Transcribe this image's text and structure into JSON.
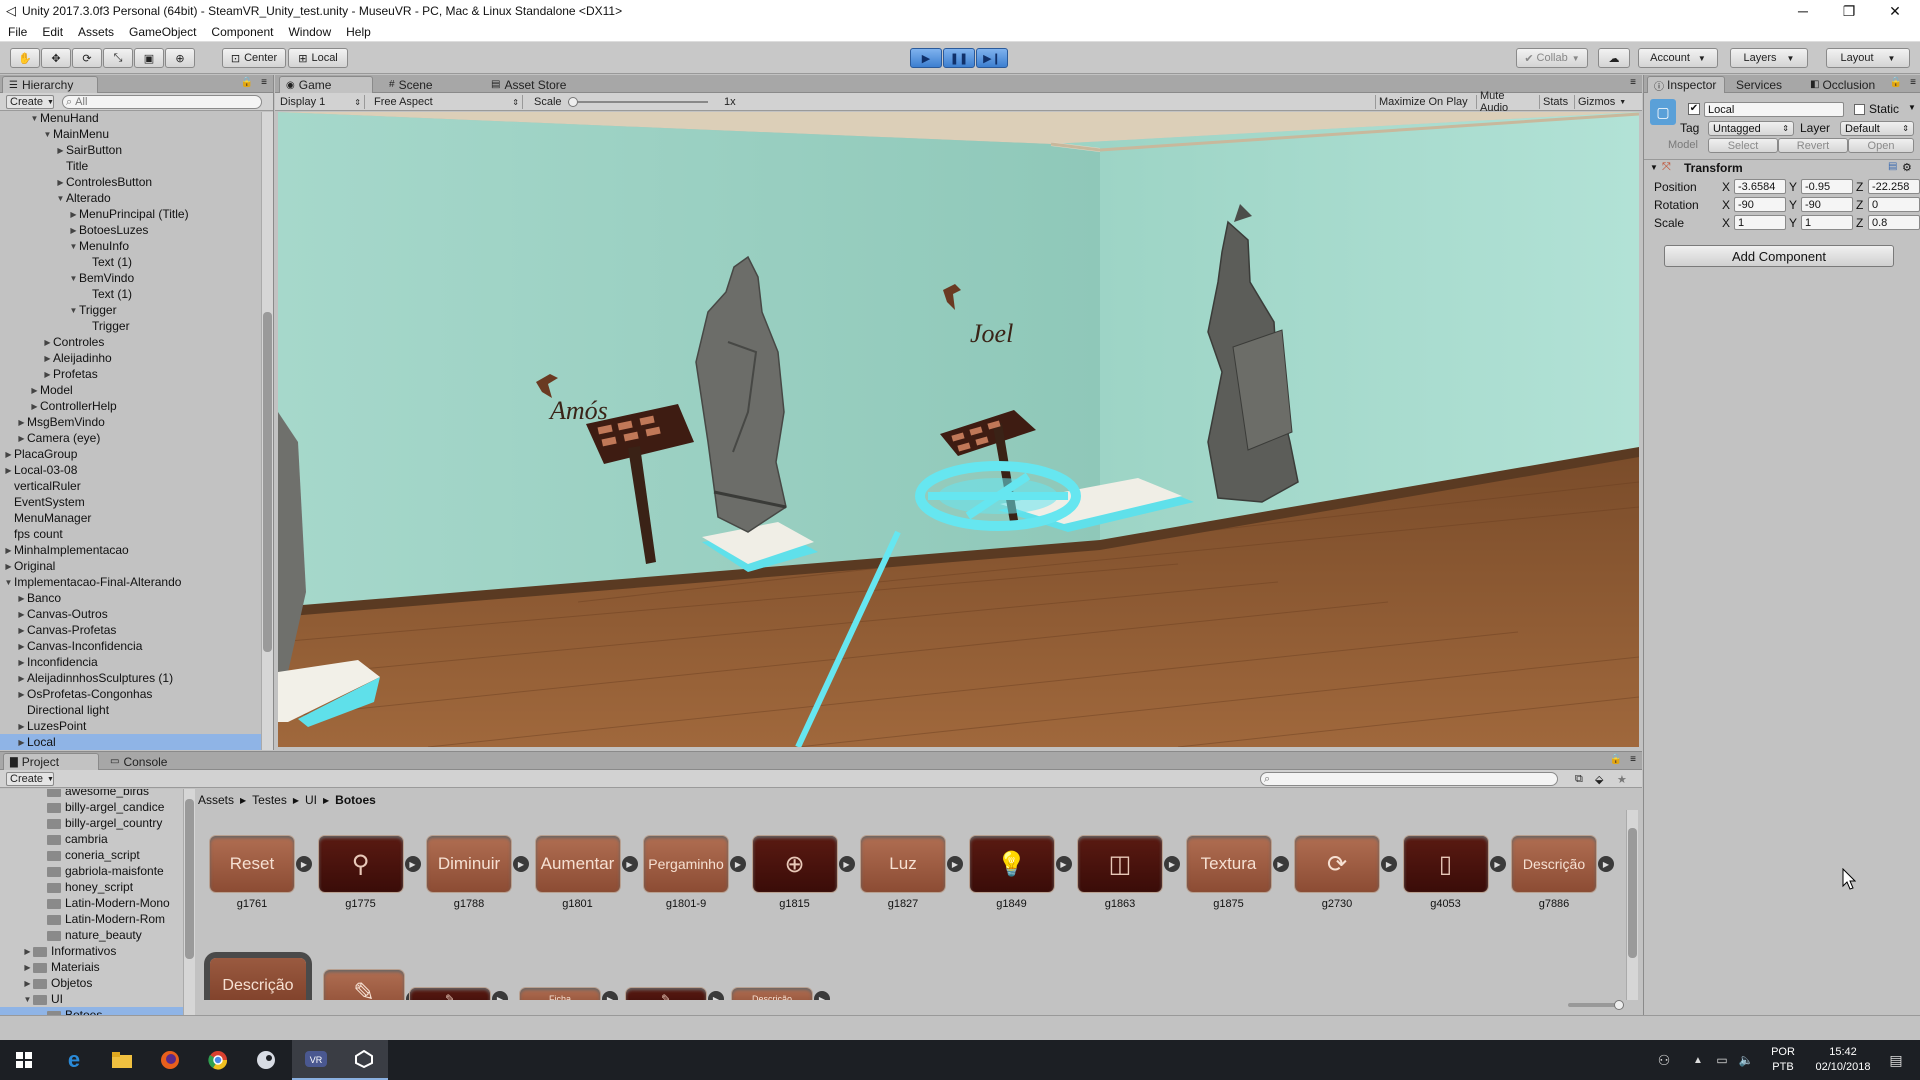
{
  "window": {
    "title": "Unity 2017.3.0f3 Personal (64bit) - SteamVR_Unity_test.unity - MuseuVR - PC, Mac & Linux Standalone <DX11>",
    "controls": [
      "─",
      "❐",
      "✕"
    ]
  },
  "menu": [
    "File",
    "Edit",
    "Assets",
    "GameObject",
    "Component",
    "Window",
    "Help"
  ],
  "toolbar": {
    "pivot": "Center",
    "space": "Local",
    "collab": "Collab",
    "account": "Account",
    "layers": "Layers",
    "layout": "Layout"
  },
  "hierarchy": {
    "tab": "Hierarchy",
    "create": "Create",
    "search_placeholder": "All",
    "rows": [
      {
        "label": "MenuHand",
        "indent": 3,
        "arrow": "down"
      },
      {
        "label": "MainMenu",
        "indent": 4,
        "arrow": "down"
      },
      {
        "label": "SairButton",
        "indent": 5,
        "arrow": "right"
      },
      {
        "label": "Title",
        "indent": 5,
        "arrow": ""
      },
      {
        "label": "ControlesButton",
        "indent": 5,
        "arrow": "right"
      },
      {
        "label": "Alterado",
        "indent": 5,
        "arrow": "down"
      },
      {
        "label": "MenuPrincipal (Title)",
        "indent": 6,
        "arrow": "right"
      },
      {
        "label": "BotoesLuzes",
        "indent": 6,
        "arrow": "right"
      },
      {
        "label": "MenuInfo",
        "indent": 6,
        "arrow": "down"
      },
      {
        "label": "Text (1)",
        "indent": 7,
        "arrow": ""
      },
      {
        "label": "BemVindo",
        "indent": 6,
        "arrow": "down"
      },
      {
        "label": "Text (1)",
        "indent": 7,
        "arrow": ""
      },
      {
        "label": "Trigger",
        "indent": 6,
        "arrow": "down"
      },
      {
        "label": "Trigger",
        "indent": 7,
        "arrow": ""
      },
      {
        "label": "Controles",
        "indent": 4,
        "arrow": "right"
      },
      {
        "label": "Aleijadinho",
        "indent": 4,
        "arrow": "right"
      },
      {
        "label": "Profetas",
        "indent": 4,
        "arrow": "right"
      },
      {
        "label": "Model",
        "indent": 3,
        "arrow": "right"
      },
      {
        "label": "ControllerHelp",
        "indent": 3,
        "arrow": "right"
      },
      {
        "label": "MsgBemVindo",
        "indent": 2,
        "arrow": "right"
      },
      {
        "label": "Camera (eye)",
        "indent": 2,
        "arrow": "right"
      },
      {
        "label": "PlacaGroup",
        "indent": 1,
        "arrow": "right"
      },
      {
        "label": "Local-03-08",
        "indent": 1,
        "arrow": "right"
      },
      {
        "label": "verticalRuler",
        "indent": 1,
        "arrow": ""
      },
      {
        "label": "EventSystem",
        "indent": 1,
        "arrow": ""
      },
      {
        "label": "MenuManager",
        "indent": 1,
        "arrow": ""
      },
      {
        "label": "fps count",
        "indent": 1,
        "arrow": ""
      },
      {
        "label": "MinhaImplementacao",
        "indent": 1,
        "arrow": "right"
      },
      {
        "label": "Original",
        "indent": 1,
        "arrow": "right"
      },
      {
        "label": "Implementacao-Final-Alterando",
        "indent": 1,
        "arrow": "down"
      },
      {
        "label": "Banco",
        "indent": 2,
        "arrow": "right"
      },
      {
        "label": "Canvas-Outros",
        "indent": 2,
        "arrow": "right"
      },
      {
        "label": "Canvas-Profetas",
        "indent": 2,
        "arrow": "right"
      },
      {
        "label": "Canvas-Inconfidencia",
        "indent": 2,
        "arrow": "right"
      },
      {
        "label": "Inconfidencia",
        "indent": 2,
        "arrow": "right"
      },
      {
        "label": "AleijadinnhosSculptures (1)",
        "indent": 2,
        "arrow": "right"
      },
      {
        "label": "OsProfetas-Congonhas",
        "indent": 2,
        "arrow": "right"
      },
      {
        "label": "Directional light",
        "indent": 2,
        "arrow": ""
      },
      {
        "label": "LuzesPoint",
        "indent": 2,
        "arrow": "right"
      },
      {
        "label": "Local",
        "indent": 2,
        "arrow": "right",
        "selected": true
      }
    ]
  },
  "game": {
    "tabs": [
      "Game",
      "Scene",
      "Asset Store"
    ],
    "display": "Display 1",
    "aspect": "Free Aspect",
    "scale_label": "Scale",
    "scale_value": "1x",
    "options": [
      "Maximize On Play",
      "Mute Audio",
      "Stats",
      "Gizmos"
    ],
    "scene_labels": [
      "Amós",
      "Joel"
    ]
  },
  "inspector": {
    "tabs": [
      "Inspector",
      "Services",
      "Occlusion"
    ],
    "name": "Local",
    "static": "Static",
    "tag_label": "Tag",
    "tag": "Untagged",
    "layer_label": "Layer",
    "layer": "Default",
    "model_label": "Model",
    "model_buttons": [
      "Select",
      "Revert",
      "Open"
    ],
    "component": "Transform",
    "transform": [
      {
        "label": "Position",
        "x": "-3.6584",
        "y": "-0.95",
        "z": "-22.258"
      },
      {
        "label": "Rotation",
        "x": "-90",
        "y": "-90",
        "z": "0"
      },
      {
        "label": "Scale",
        "x": "1",
        "y": "1",
        "z": "0.8"
      }
    ],
    "axis": [
      "X",
      "Y",
      "Z"
    ],
    "add_component": "Add Component"
  },
  "project": {
    "tabs": [
      "Project",
      "Console"
    ],
    "create": "Create",
    "folders": [
      {
        "label": "awesome_birds",
        "indent": 3
      },
      {
        "label": "billy-argel_candice",
        "indent": 3
      },
      {
        "label": "billy-argel_country",
        "indent": 3
      },
      {
        "label": "cambria",
        "indent": 3
      },
      {
        "label": "coneria_script",
        "indent": 3
      },
      {
        "label": "gabriola-maisfonte",
        "indent": 3
      },
      {
        "label": "honey_script",
        "indent": 3
      },
      {
        "label": "Latin-Modern-Mono",
        "indent": 3
      },
      {
        "label": "Latin-Modern-Rom",
        "indent": 3
      },
      {
        "label": "nature_beauty",
        "indent": 3
      },
      {
        "label": "Informativos",
        "indent": 2,
        "arrow": "right"
      },
      {
        "label": "Materiais",
        "indent": 2,
        "arrow": "right"
      },
      {
        "label": "Objetos",
        "indent": 2,
        "arrow": "right"
      },
      {
        "label": "UI",
        "indent": 2,
        "arrow": "down"
      },
      {
        "label": "Botoes",
        "indent": 3,
        "selected": true
      }
    ],
    "breadcrumb": [
      "Assets",
      "Testes",
      "UI",
      "Botoes"
    ],
    "assets_row1": [
      {
        "label": "Reset",
        "name": "g1761",
        "style": "light",
        "kind": "text"
      },
      {
        "label": "",
        "name": "g1775",
        "style": "dark",
        "kind": "search-icon"
      },
      {
        "label": "Diminuir",
        "name": "g1788",
        "style": "light",
        "kind": "text"
      },
      {
        "label": "Aumentar",
        "name": "g1801",
        "style": "light",
        "kind": "text"
      },
      {
        "label": "Pergaminho",
        "name": "g1801-9",
        "style": "light",
        "kind": "text"
      },
      {
        "label": "",
        "name": "g1815",
        "style": "dark",
        "kind": "zoom-icon"
      },
      {
        "label": "Luz",
        "name": "g1827",
        "style": "light",
        "kind": "text"
      },
      {
        "label": "",
        "name": "g1849",
        "style": "dark",
        "kind": "bulb-icon"
      },
      {
        "label": "",
        "name": "g1863",
        "style": "dark",
        "kind": "cube-icon"
      },
      {
        "label": "Textura",
        "name": "g1875",
        "style": "light",
        "kind": "text"
      },
      {
        "label": "",
        "name": "g2730",
        "style": "light",
        "kind": "refresh-icon"
      },
      {
        "label": "",
        "name": "g4053",
        "style": "dark",
        "kind": "scroll-icon"
      },
      {
        "label": "Descrição",
        "name": "g7886",
        "style": "light",
        "kind": "text"
      }
    ],
    "assets_row2": [
      {
        "label": "Descrição",
        "style": "light"
      },
      {
        "label": "",
        "style": "light"
      },
      {
        "label": "",
        "style": "dark"
      },
      {
        "label": "Ficha",
        "style": "light"
      },
      {
        "label": "",
        "style": "dark"
      },
      {
        "label": "Descrição",
        "style": "light"
      }
    ]
  },
  "taskbar": {
    "lang": "POR",
    "layout": "PTB",
    "time": "15:42",
    "date": "02/10/2018"
  },
  "colors": {
    "editor_bg": "#c2c2c2",
    "wall": "#9fd2c4",
    "floor": "#8a5a34",
    "accent_cyan": "#66e6f0",
    "selection": "#8fb4e6",
    "taskbar": "#1c1f24"
  }
}
